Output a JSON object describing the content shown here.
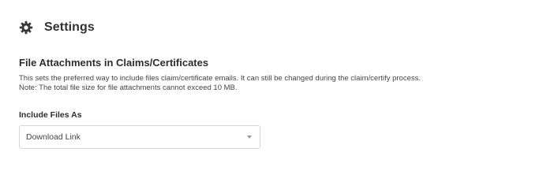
{
  "header": {
    "icon": "gear-icon",
    "title": "Settings"
  },
  "section": {
    "title": "File Attachments in Claims/Certificates",
    "description_line1": "This sets the preferred way to include files claim/certificate emails. It can still be changed during the claim/certify process.",
    "description_line2": "Note: The total file size for file attachments cannot exceed 10 MB."
  },
  "include_files": {
    "label": "Include Files As",
    "selected": "Download Link",
    "caret_icon": "chevron-down-icon"
  },
  "colors": {
    "text": "#2b2b2b",
    "border": "#d6d6d6",
    "caret": "#9a9a9a"
  }
}
